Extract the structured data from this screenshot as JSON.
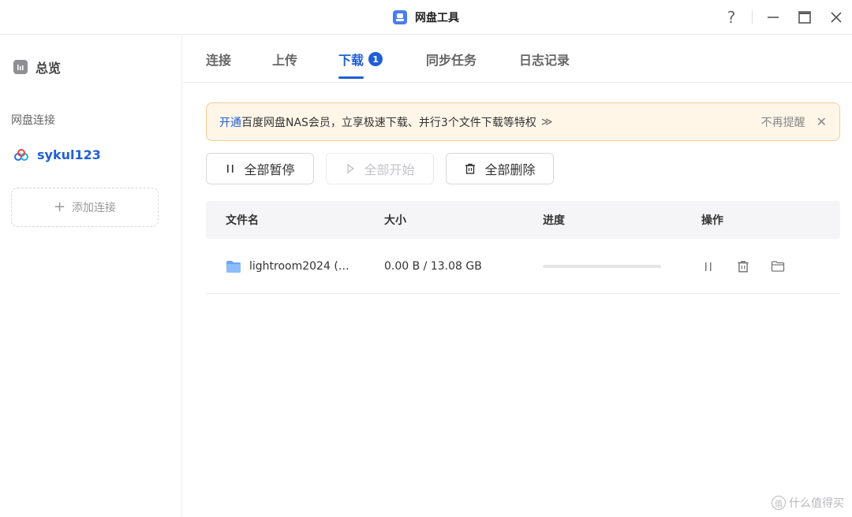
{
  "window": {
    "title": "网盘工具",
    "help_label": "?",
    "minimize_label": "—",
    "maximize_label": "☐",
    "close_label": "✕"
  },
  "sidebar": {
    "overview_label": "总览",
    "section_label": "网盘连接",
    "connection_name": "sykul123",
    "add_connection_label": "添加连接"
  },
  "tabs": [
    {
      "label": "连接"
    },
    {
      "label": "上传"
    },
    {
      "label": "下载",
      "badge": "1"
    },
    {
      "label": "同步任务"
    },
    {
      "label": "日志记录"
    }
  ],
  "banner": {
    "link_text": "开通",
    "message": "百度网盘NAS会员，立享极速下载、并行3个文件下载等特权",
    "arrow": "≫",
    "dismiss_label": "不再提醒",
    "close_glyph": "✕"
  },
  "actions": {
    "pause_all": "全部暂停",
    "start_all": "全部开始",
    "delete_all": "全部删除"
  },
  "table": {
    "headers": {
      "name": "文件名",
      "size": "大小",
      "progress": "进度",
      "ops": "操作"
    },
    "rows": [
      {
        "name": "lightroom2024 (…",
        "size": "0.00 B / 13.08 GB",
        "progress": 0
      }
    ]
  },
  "watermark": {
    "text": "什么值得买",
    "icon_glyph": "值"
  },
  "colors": {
    "accent": "#1f5fd6",
    "banner_bg": "#fff6e8",
    "banner_border": "#f3cc95"
  }
}
